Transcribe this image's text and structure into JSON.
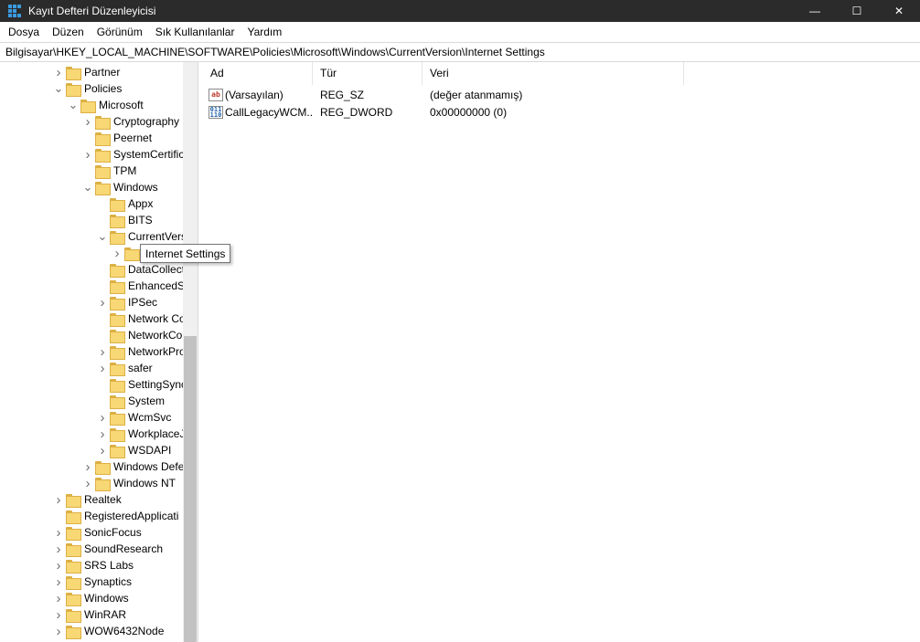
{
  "window": {
    "title": "Kayıt Defteri Düzenleyicisi",
    "controls": {
      "minimize": "—",
      "maximize": "☐",
      "close": "✕"
    }
  },
  "menu": [
    "Dosya",
    "Düzen",
    "Görünüm",
    "Sık Kullanılanlar",
    "Yardım"
  ],
  "address": "Bilgisayar\\HKEY_LOCAL_MACHINE\\SOFTWARE\\Policies\\Microsoft\\Windows\\CurrentVersion\\Internet Settings",
  "tree": [
    {
      "label": "Partner",
      "level": 0,
      "expander": "collapsed"
    },
    {
      "label": "Policies",
      "level": 0,
      "expander": "expanded"
    },
    {
      "label": "Microsoft",
      "level": 1,
      "expander": "expanded"
    },
    {
      "label": "Cryptography",
      "level": 2,
      "expander": "collapsed"
    },
    {
      "label": "Peernet",
      "level": 2,
      "expander": "none"
    },
    {
      "label": "SystemCertific",
      "level": 2,
      "expander": "collapsed"
    },
    {
      "label": "TPM",
      "level": 2,
      "expander": "none"
    },
    {
      "label": "Windows",
      "level": 2,
      "expander": "expanded"
    },
    {
      "label": "Appx",
      "level": 3,
      "expander": "none"
    },
    {
      "label": "BITS",
      "level": 3,
      "expander": "none"
    },
    {
      "label": "CurrentVers",
      "level": 3,
      "expander": "expanded"
    },
    {
      "label": "",
      "level": 4,
      "expander": "collapsed"
    },
    {
      "label": "DataCollect",
      "level": 3,
      "expander": "none"
    },
    {
      "label": "EnhancedS",
      "level": 3,
      "expander": "none"
    },
    {
      "label": "IPSec",
      "level": 3,
      "expander": "collapsed"
    },
    {
      "label": "Network Co",
      "level": 3,
      "expander": "none"
    },
    {
      "label": "NetworkCo",
      "level": 3,
      "expander": "none"
    },
    {
      "label": "NetworkPro",
      "level": 3,
      "expander": "collapsed"
    },
    {
      "label": "safer",
      "level": 3,
      "expander": "collapsed"
    },
    {
      "label": "SettingSync",
      "level": 3,
      "expander": "none"
    },
    {
      "label": "System",
      "level": 3,
      "expander": "none"
    },
    {
      "label": "WcmSvc",
      "level": 3,
      "expander": "collapsed"
    },
    {
      "label": "WorkplaceJ",
      "level": 3,
      "expander": "collapsed"
    },
    {
      "label": "WSDAPI",
      "level": 3,
      "expander": "collapsed"
    },
    {
      "label": "Windows Defe",
      "level": 2,
      "expander": "collapsed"
    },
    {
      "label": "Windows NT",
      "level": 2,
      "expander": "collapsed"
    },
    {
      "label": "Realtek",
      "level": 0,
      "expander": "collapsed"
    },
    {
      "label": "RegisteredApplicati",
      "level": 0,
      "expander": "none"
    },
    {
      "label": "SonicFocus",
      "level": 0,
      "expander": "collapsed"
    },
    {
      "label": "SoundResearch",
      "level": 0,
      "expander": "collapsed"
    },
    {
      "label": "SRS Labs",
      "level": 0,
      "expander": "collapsed"
    },
    {
      "label": "Synaptics",
      "level": 0,
      "expander": "collapsed"
    },
    {
      "label": "Windows",
      "level": 0,
      "expander": "collapsed"
    },
    {
      "label": "WinRAR",
      "level": 0,
      "expander": "collapsed"
    },
    {
      "label": "WOW6432Node",
      "level": 0,
      "expander": "collapsed"
    }
  ],
  "tooltip": "Internet Settings",
  "list": {
    "columns": [
      "Ad",
      "Tür",
      "Veri"
    ],
    "rows": [
      {
        "icon": "string-value-icon",
        "icon_text": "ab",
        "name": "(Varsayılan)",
        "type": "REG_SZ",
        "data": "(değer atanmamış)"
      },
      {
        "icon": "dword-value-icon",
        "icon_text": "011\n110",
        "name": "CallLegacyWCM...",
        "type": "REG_DWORD",
        "data": "0x00000000 (0)"
      }
    ]
  }
}
